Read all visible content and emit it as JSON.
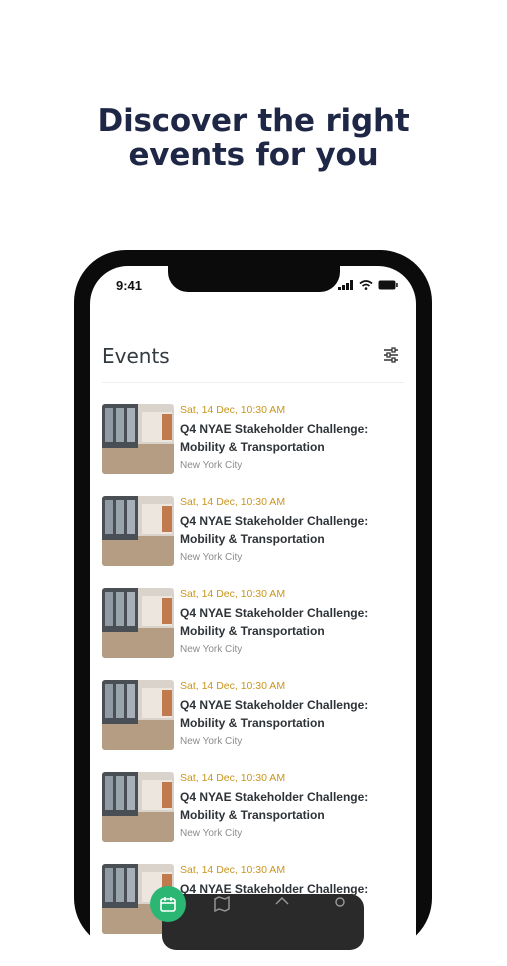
{
  "headline": {
    "line1": "Discover the right",
    "line2": "events for you"
  },
  "status_bar": {
    "time": "9:41"
  },
  "events_header": {
    "title": "Events",
    "filter_icon": "sliders-icon"
  },
  "events": [
    {
      "date": "Sat, 14 Dec, 10:30 AM",
      "title_line1": "Q4 NYAE Stakeholder Challenge:",
      "title_line2": "Mobility & Transportation",
      "location": "New York City"
    },
    {
      "date": "Sat, 14 Dec, 10:30 AM",
      "title_line1": "Q4 NYAE Stakeholder Challenge:",
      "title_line2": "Mobility & Transportation",
      "location": "New York City"
    },
    {
      "date": "Sat, 14 Dec, 10:30 AM",
      "title_line1": "Q4 NYAE Stakeholder Challenge:",
      "title_line2": "Mobility & Transportation",
      "location": "New York City"
    },
    {
      "date": "Sat, 14 Dec, 10:30 AM",
      "title_line1": "Q4 NYAE Stakeholder Challenge:",
      "title_line2": "Mobility & Transportation",
      "location": "New York City"
    },
    {
      "date": "Sat, 14 Dec, 10:30 AM",
      "title_line1": "Q4 NYAE Stakeholder Challenge:",
      "title_line2": "Mobility & Transportation",
      "location": "New York City"
    },
    {
      "date": "Sat, 14 Dec, 10:30 AM",
      "title_line1": "Q4 NYAE Stakeholder Challenge:",
      "title_line2": "",
      "location": ""
    }
  ],
  "tab_bar": {
    "items": [
      "calendar-icon",
      "map-icon",
      "home-icon",
      "profile-icon"
    ],
    "active": "calendar-icon"
  },
  "colors": {
    "headline": "#1f2746",
    "date": "#c8951c",
    "active_tab": "#2bb673",
    "tab_bar": "#2a2a2a"
  }
}
